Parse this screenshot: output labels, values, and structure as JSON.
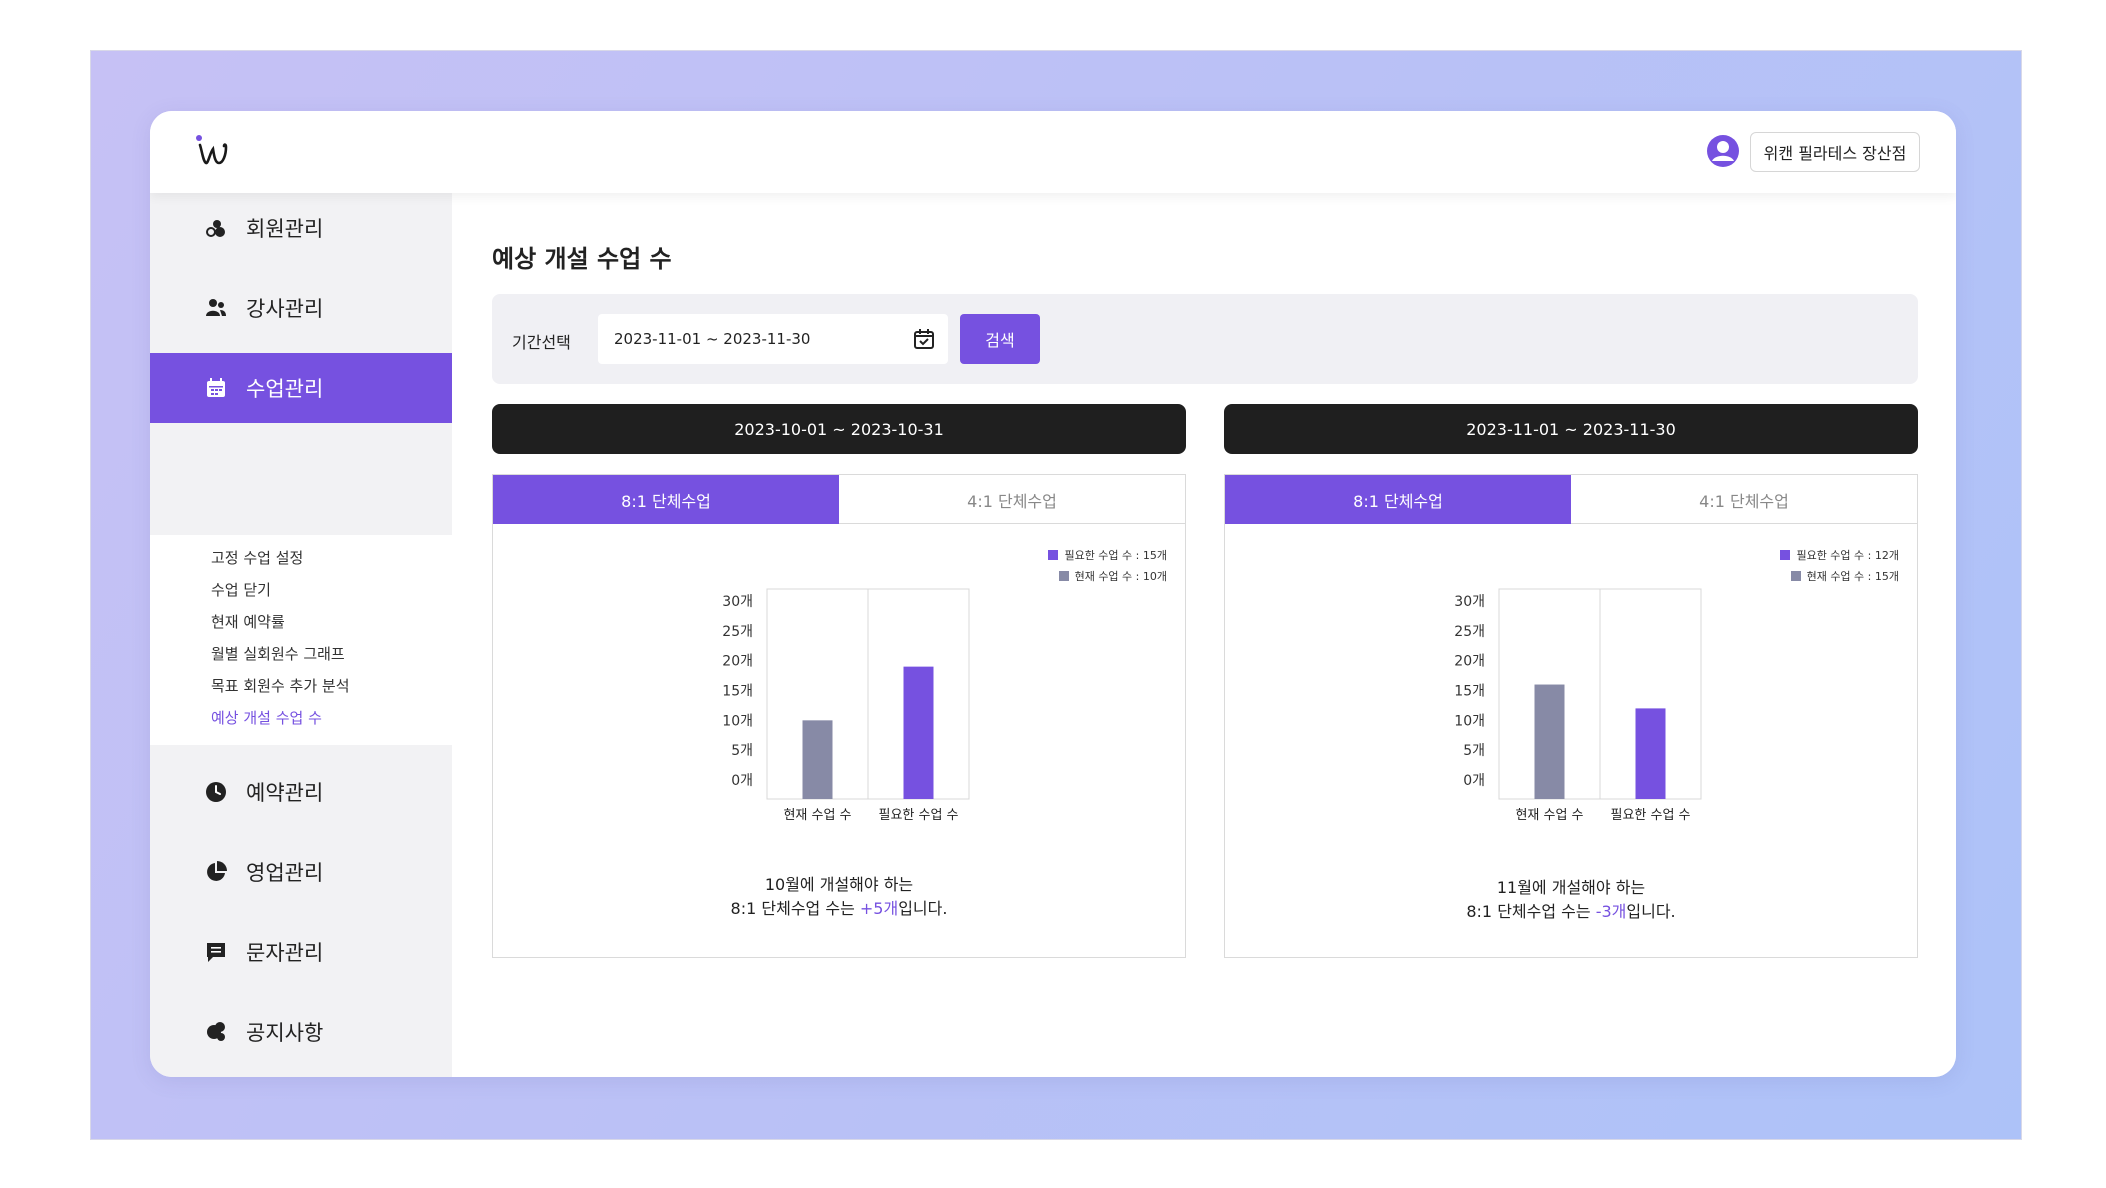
{
  "app": {
    "brand_color": "#7651e0",
    "logo_icon": "w-script-logo-icon",
    "user_icon": "user-circle-icon",
    "branch_name": "위캔 필라테스 장산점"
  },
  "sidebar": {
    "items": [
      {
        "label": "회원관리",
        "icon": "members-icon"
      },
      {
        "label": "강사관리",
        "icon": "instructors-icon"
      },
      {
        "label": "수업관리",
        "icon": "calendar-icon",
        "active": true
      },
      {
        "label": "예약관리",
        "icon": "clock-icon"
      },
      {
        "label": "영업관리",
        "icon": "pie-chart-icon"
      },
      {
        "label": "문자관리",
        "icon": "message-icon"
      },
      {
        "label": "공지사항",
        "icon": "megaphone-icon"
      }
    ],
    "submenu": [
      {
        "label": "고정 수업 설정"
      },
      {
        "label": "수업 닫기"
      },
      {
        "label": "현재 예약률"
      },
      {
        "label": "월별 실회원수 그래프"
      },
      {
        "label": "목표 회원수 추가 분석"
      },
      {
        "label": "예상 개설 수업 수",
        "active": true
      }
    ]
  },
  "main": {
    "title": "예상 개설 수업 수",
    "filter": {
      "label": "기간선택",
      "date_range": "2023-11-01 ~ 2023-11-30",
      "search_label": "검색"
    },
    "periods": [
      {
        "header": "2023-10-01 ~ 2023-10-31",
        "tabs": [
          "8:1 단체수업",
          "4:1 단체수업"
        ],
        "legend": [
          {
            "label": "필요한 수업 수 :",
            "value": "15개"
          },
          {
            "label": "현재 수업 수 :",
            "value": "10개"
          }
        ],
        "summary_line1": "10월에 개설해야 하는",
        "summary_prefix": "8:1 단체수업 수는 ",
        "summary_highlight": "+5개",
        "summary_suffix": "입니다."
      },
      {
        "header": "2023-11-01 ~ 2023-11-30",
        "tabs": [
          "8:1 단체수업",
          "4:1 단체수업"
        ],
        "legend": [
          {
            "label": "필요한 수업 수 :",
            "value": "12개"
          },
          {
            "label": "현재 수업 수 :",
            "value": "15개"
          }
        ],
        "summary_line1": "11월에 개설해야 하는",
        "summary_prefix": "8:1 단체수업 수는 ",
        "summary_highlight": "-3개",
        "summary_suffix": "입니다."
      }
    ]
  },
  "chart_data": [
    {
      "type": "bar",
      "categories": [
        "현재 수업 수",
        "필요한 수업 수"
      ],
      "values": [
        10,
        19
      ],
      "colors": [
        "#878aa6",
        "#7651e0"
      ],
      "ylim": [
        0,
        30
      ],
      "yticks": [
        "0개",
        "5개",
        "10개",
        "15개",
        "20개",
        "25개",
        "30개"
      ],
      "grid": true
    },
    {
      "type": "bar",
      "categories": [
        "현재 수업 수",
        "필요한 수업 수"
      ],
      "values": [
        16,
        12
      ],
      "colors": [
        "#878aa6",
        "#7651e0"
      ],
      "ylim": [
        0,
        30
      ],
      "yticks": [
        "0개",
        "5개",
        "10개",
        "15개",
        "20개",
        "25개",
        "30개"
      ],
      "grid": true
    }
  ]
}
